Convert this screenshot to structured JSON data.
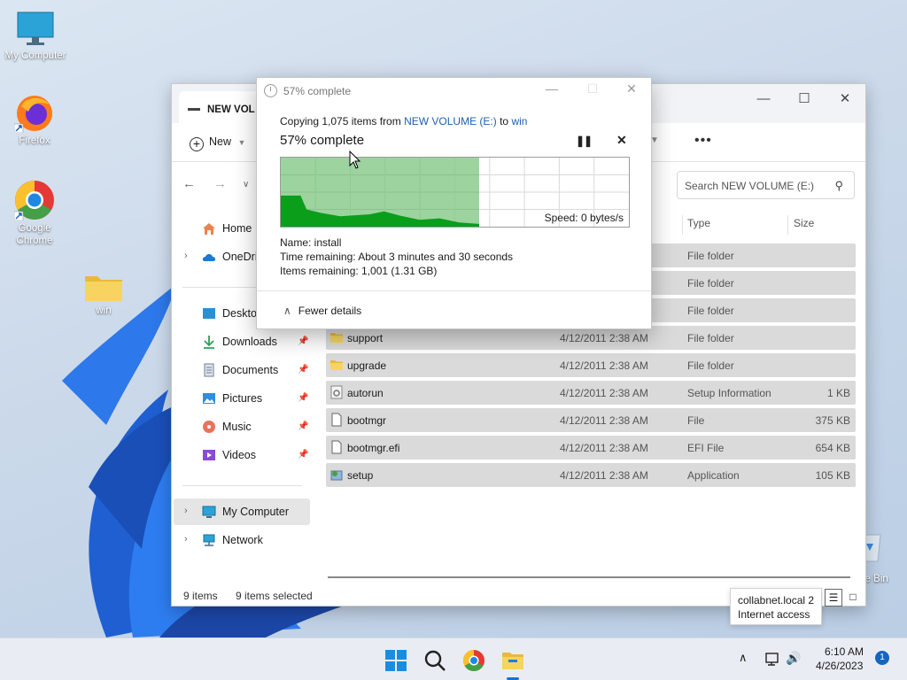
{
  "desktop": {
    "icons": [
      {
        "label": "My Computer",
        "icon": "monitor-icon"
      },
      {
        "label": "Firefox",
        "icon": "firefox-icon"
      },
      {
        "label": "Google Chrome",
        "icon": "chrome-icon"
      },
      {
        "label": "win",
        "icon": "folder-icon"
      }
    ],
    "recycle_bin_label_partial": "le Bin"
  },
  "explorer": {
    "tab_title": "NEW VOL",
    "toolbar": {
      "new_label": "New"
    },
    "search_placeholder": "Search NEW VOLUME (E:)",
    "sidebar": {
      "home": "Home",
      "onedrive": "OneDriv",
      "desktop": "Desktop",
      "downloads": "Downloads",
      "documents": "Documents",
      "pictures": "Pictures",
      "music": "Music",
      "videos": "Videos",
      "my_computer": "My Computer",
      "network": "Network"
    },
    "columns": {
      "type": "Type",
      "size": "Size"
    },
    "files": [
      {
        "name": "",
        "date": "",
        "type": "File folder",
        "size": "",
        "icon": "folder-icon"
      },
      {
        "name": "",
        "date": "",
        "type": "File folder",
        "size": "",
        "icon": "folder-icon"
      },
      {
        "name": "",
        "date": "",
        "type": "File folder",
        "size": "",
        "icon": "folder-icon"
      },
      {
        "name": "support",
        "date": "4/12/2011 2:38 AM",
        "type": "File folder",
        "size": "",
        "icon": "folder-icon"
      },
      {
        "name": "upgrade",
        "date": "4/12/2011 2:38 AM",
        "type": "File folder",
        "size": "",
        "icon": "folder-icon"
      },
      {
        "name": "autorun",
        "date": "4/12/2011 2:38 AM",
        "type": "Setup Information",
        "size": "1 KB",
        "icon": "settings-file-icon"
      },
      {
        "name": "bootmgr",
        "date": "4/12/2011 2:38 AM",
        "type": "File",
        "size": "375 KB",
        "icon": "file-icon"
      },
      {
        "name": "bootmgr.efi",
        "date": "4/12/2011 2:38 AM",
        "type": "EFI File",
        "size": "654 KB",
        "icon": "file-icon"
      },
      {
        "name": "setup",
        "date": "4/12/2011 2:38 AM",
        "type": "Application",
        "size": "105 KB",
        "icon": "setup-app-icon"
      }
    ],
    "status": {
      "items": "9 items",
      "selected": "9 items selected"
    }
  },
  "copy_dialog": {
    "title": "57% complete",
    "copy_prefix": "Copying 1,075 items from",
    "source": "NEW VOLUME (E:)",
    "to_word": "to",
    "destination": "win",
    "progress_text": "57% complete",
    "progress_fraction": 0.57,
    "speed": "Speed: 0 bytes/s",
    "name_line": "Name:  install",
    "time_remaining": "Time remaining:  About 3 minutes and 30 seconds",
    "items_remaining": "Items remaining:  1,001 (1.31 GB)",
    "fewer_details": "Fewer details",
    "accent_color": "#4caf50"
  },
  "tooltip": {
    "line1": "collabnet.local 2",
    "line2": "Internet access"
  },
  "taskbar": {
    "time": "6:10 AM",
    "date": "4/26/2023",
    "notification_count": "1"
  }
}
